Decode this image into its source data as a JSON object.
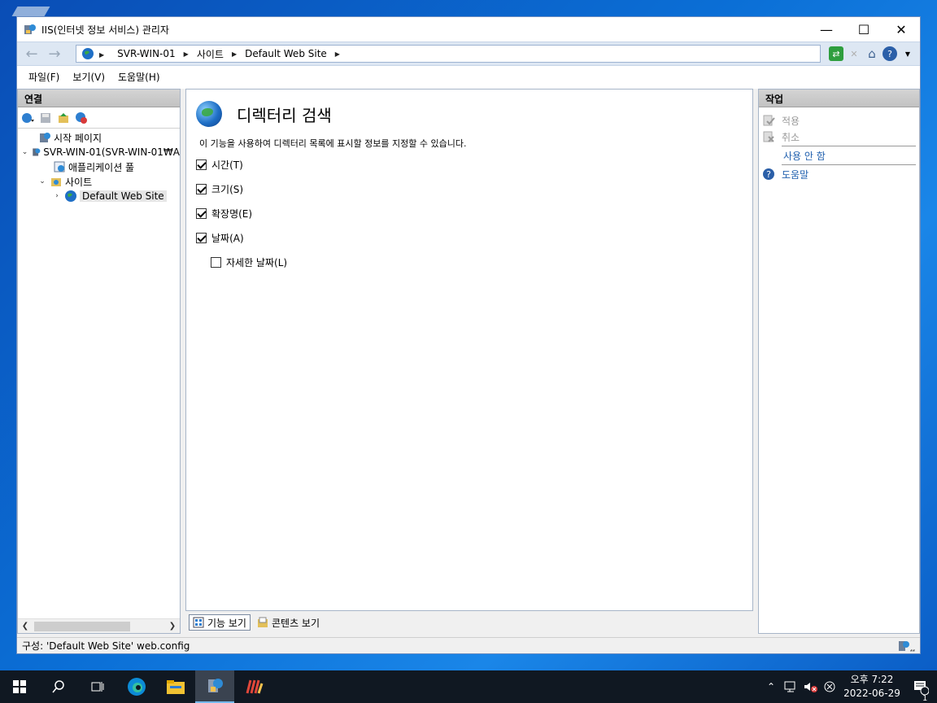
{
  "window": {
    "title": "IIS(인터넷 정보 서비스) 관리자",
    "minimize": "—",
    "maximize": "☐",
    "close": "✕"
  },
  "address": {
    "segments": [
      "SVR-WIN-01",
      "사이트",
      "Default Web Site"
    ]
  },
  "menubar": [
    "파일(F)",
    "보기(V)",
    "도움말(H)"
  ],
  "connections": {
    "header": "연결",
    "tree": [
      {
        "label": "시작 페이지",
        "icon": "start-page-icon"
      },
      {
        "label": "SVR-WIN-01(SVR-WIN-01₩A",
        "icon": "server-icon"
      },
      {
        "label": "애플리케이션 풀",
        "icon": "app-pool-icon"
      },
      {
        "label": "사이트",
        "icon": "sites-folder-icon"
      },
      {
        "label": "Default Web Site",
        "icon": "globe-icon"
      }
    ]
  },
  "feature": {
    "title": "디렉터리 검색",
    "description": "이 기능을 사용하여 디렉터리 목록에 표시할 정보를 지정할 수 있습니다.",
    "options": [
      {
        "label": "시간(T)",
        "checked": true
      },
      {
        "label": "크기(S)",
        "checked": true
      },
      {
        "label": "확장명(E)",
        "checked": true
      },
      {
        "label": "날짜(A)",
        "checked": true
      },
      {
        "label": "자세한 날짜(L)",
        "checked": false
      }
    ]
  },
  "view_tabs": {
    "features": "기능 보기",
    "content": "콘텐츠 보기"
  },
  "actions": {
    "header": "작업",
    "apply": "적용",
    "cancel": "취소",
    "disable": "사용 안 함",
    "help": "도움말"
  },
  "status": {
    "text": "구성: 'Default Web Site' web.config"
  },
  "taskbar": {
    "time_period": "오후 7:22",
    "date": "2022-06-29",
    "notification_count": "1"
  }
}
